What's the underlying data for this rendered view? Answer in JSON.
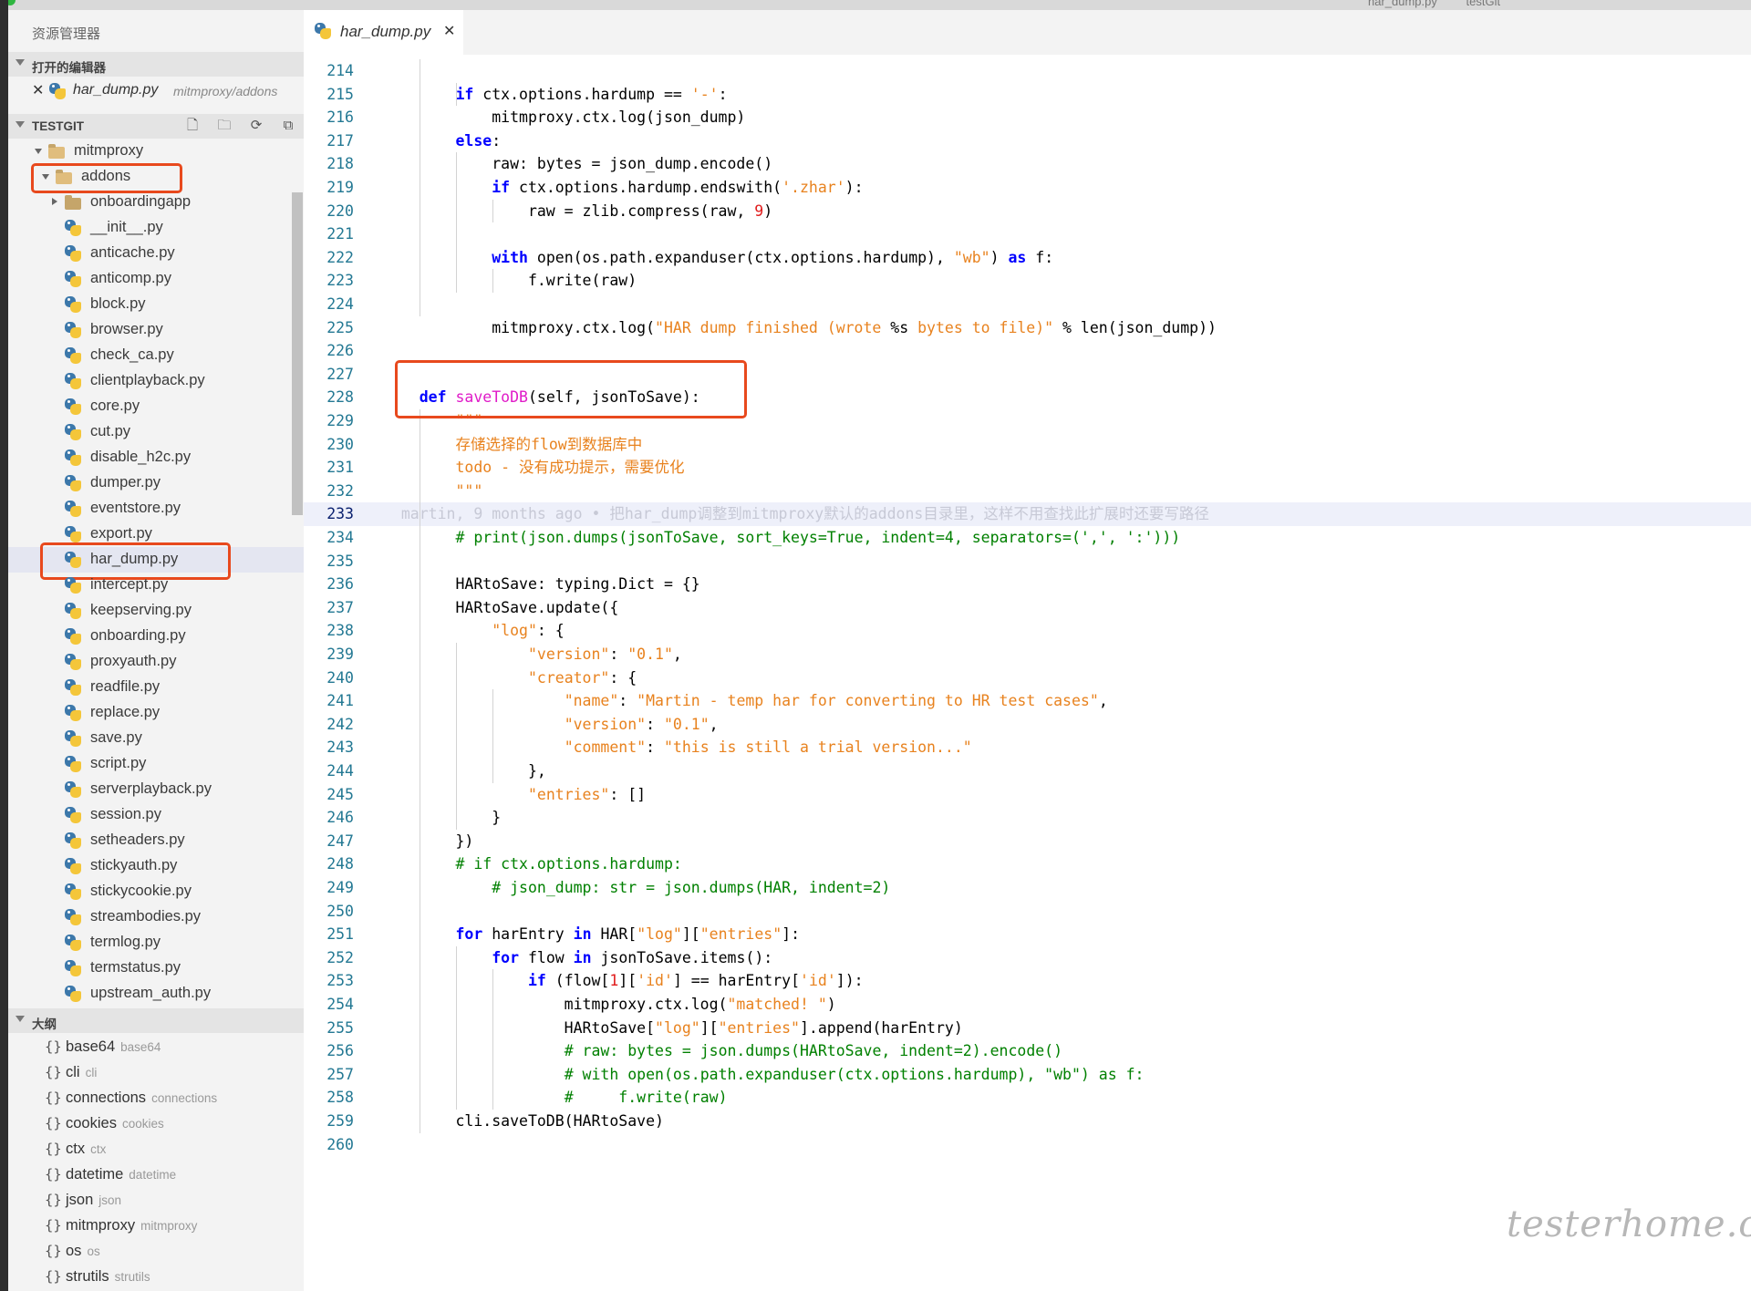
{
  "window": {
    "top_strip_text": [
      "har_dump.py",
      "testGit"
    ]
  },
  "sidebar": {
    "title": "资源管理器",
    "open_editors": {
      "label": "打开的编辑器",
      "items": [
        {
          "close": "✕",
          "name": "har_dump.py",
          "path": "mitmproxy/addons"
        }
      ]
    },
    "workspace": {
      "label": "TESTGIT",
      "actions": [
        {
          "name": "new-file",
          "glyph": "🗋"
        },
        {
          "name": "new-folder",
          "glyph": "🗀"
        },
        {
          "name": "refresh",
          "glyph": "⟳"
        },
        {
          "name": "collapse-all",
          "glyph": "⧉"
        }
      ],
      "tree": [
        {
          "label": "mitmproxy",
          "kind": "folder-open",
          "depth": 0
        },
        {
          "label": "addons",
          "kind": "folder-open",
          "depth": 1,
          "highlighted": true
        },
        {
          "label": "onboardingapp",
          "kind": "folder-closed",
          "depth": 2
        },
        {
          "label": "__init__.py",
          "kind": "py",
          "depth": 2
        },
        {
          "label": "anticache.py",
          "kind": "py",
          "depth": 2
        },
        {
          "label": "anticomp.py",
          "kind": "py",
          "depth": 2
        },
        {
          "label": "block.py",
          "kind": "py",
          "depth": 2
        },
        {
          "label": "browser.py",
          "kind": "py",
          "depth": 2
        },
        {
          "label": "check_ca.py",
          "kind": "py",
          "depth": 2
        },
        {
          "label": "clientplayback.py",
          "kind": "py",
          "depth": 2
        },
        {
          "label": "core.py",
          "kind": "py",
          "depth": 2
        },
        {
          "label": "cut.py",
          "kind": "py",
          "depth": 2
        },
        {
          "label": "disable_h2c.py",
          "kind": "py",
          "depth": 2
        },
        {
          "label": "dumper.py",
          "kind": "py",
          "depth": 2
        },
        {
          "label": "eventstore.py",
          "kind": "py",
          "depth": 2
        },
        {
          "label": "export.py",
          "kind": "py",
          "depth": 2
        },
        {
          "label": "har_dump.py",
          "kind": "py",
          "depth": 2,
          "selected": true,
          "highlighted": true
        },
        {
          "label": "intercept.py",
          "kind": "py",
          "depth": 2
        },
        {
          "label": "keepserving.py",
          "kind": "py",
          "depth": 2
        },
        {
          "label": "onboarding.py",
          "kind": "py",
          "depth": 2
        },
        {
          "label": "proxyauth.py",
          "kind": "py",
          "depth": 2
        },
        {
          "label": "readfile.py",
          "kind": "py",
          "depth": 2
        },
        {
          "label": "replace.py",
          "kind": "py",
          "depth": 2
        },
        {
          "label": "save.py",
          "kind": "py",
          "depth": 2
        },
        {
          "label": "script.py",
          "kind": "py",
          "depth": 2
        },
        {
          "label": "serverplayback.py",
          "kind": "py",
          "depth": 2
        },
        {
          "label": "session.py",
          "kind": "py",
          "depth": 2
        },
        {
          "label": "setheaders.py",
          "kind": "py",
          "depth": 2
        },
        {
          "label": "stickyauth.py",
          "kind": "py",
          "depth": 2
        },
        {
          "label": "stickycookie.py",
          "kind": "py",
          "depth": 2
        },
        {
          "label": "streambodies.py",
          "kind": "py",
          "depth": 2
        },
        {
          "label": "termlog.py",
          "kind": "py",
          "depth": 2
        },
        {
          "label": "termstatus.py",
          "kind": "py",
          "depth": 2
        },
        {
          "label": "upstream_auth.py",
          "kind": "py",
          "depth": 2
        }
      ]
    },
    "outline": {
      "label": "大纲",
      "items": [
        {
          "symbol": "{}",
          "name": "base64",
          "detail": "base64"
        },
        {
          "symbol": "{}",
          "name": "cli",
          "detail": "cli"
        },
        {
          "symbol": "{}",
          "name": "connections",
          "detail": "connections"
        },
        {
          "symbol": "{}",
          "name": "cookies",
          "detail": "cookies"
        },
        {
          "symbol": "{}",
          "name": "ctx",
          "detail": "ctx"
        },
        {
          "symbol": "{}",
          "name": "datetime",
          "detail": "datetime"
        },
        {
          "symbol": "{}",
          "name": "json",
          "detail": "json"
        },
        {
          "symbol": "{}",
          "name": "mitmproxy",
          "detail": "mitmproxy"
        },
        {
          "symbol": "{}",
          "name": "os",
          "detail": "os"
        },
        {
          "symbol": "{}",
          "name": "strutils",
          "detail": "strutils"
        }
      ]
    }
  },
  "editor": {
    "tab": {
      "label": "har_dump.py",
      "close": "✕"
    },
    "current_line": 233,
    "lines": [
      {
        "n": "214",
        "segs": []
      },
      {
        "n": "215",
        "segs": [
          [
            "",
            "        "
          ],
          [
            "kw",
            "if"
          ],
          [
            "",
            " ctx.options.hardump == "
          ],
          [
            "st",
            "'-'"
          ],
          [
            "",
            ":"
          ]
        ]
      },
      {
        "n": "216",
        "segs": [
          [
            "",
            "            mitmproxy.ctx.log(json_dump)"
          ]
        ]
      },
      {
        "n": "217",
        "segs": [
          [
            "",
            "        "
          ],
          [
            "kw",
            "else"
          ],
          [
            "",
            ":"
          ]
        ]
      },
      {
        "n": "218",
        "segs": [
          [
            "",
            "            raw: bytes = json_dump.encode()"
          ]
        ]
      },
      {
        "n": "219",
        "segs": [
          [
            "",
            "            "
          ],
          [
            "kw",
            "if"
          ],
          [
            "",
            " ctx.options.hardump.endswith("
          ],
          [
            "st",
            "'.zhar'"
          ],
          [
            "",
            "):"
          ]
        ]
      },
      {
        "n": "220",
        "segs": [
          [
            "",
            "                raw = zlib.compress(raw, "
          ],
          [
            "nr",
            "9"
          ],
          [
            "",
            ")"
          ]
        ]
      },
      {
        "n": "221",
        "segs": []
      },
      {
        "n": "222",
        "segs": [
          [
            "",
            "            "
          ],
          [
            "kw",
            "with"
          ],
          [
            "",
            " open(os.path.expanduser(ctx.options.hardump), "
          ],
          [
            "st",
            "\"wb\""
          ],
          [
            "",
            ") "
          ],
          [
            "kw",
            "as"
          ],
          [
            "",
            " f:"
          ]
        ]
      },
      {
        "n": "223",
        "segs": [
          [
            "",
            "                f.write(raw)"
          ]
        ]
      },
      {
        "n": "224",
        "segs": []
      },
      {
        "n": "225",
        "segs": [
          [
            "",
            "            mitmproxy.ctx.log("
          ],
          [
            "st",
            "\"HAR dump finished (wrote "
          ],
          [
            "",
            "%s"
          ],
          [
            "st",
            " bytes to file)\""
          ],
          [
            "",
            " % len(json_dump))"
          ]
        ]
      },
      {
        "n": "226",
        "segs": []
      },
      {
        "n": "227",
        "segs": []
      },
      {
        "n": "228",
        "segs": [
          [
            "",
            "    "
          ],
          [
            "kw",
            "def"
          ],
          [
            "",
            " "
          ],
          [
            "fn",
            "saveToDB"
          ],
          [
            "",
            "(self, jsonToSave):"
          ]
        ]
      },
      {
        "n": "229",
        "segs": [
          [
            "",
            "        "
          ],
          [
            "st",
            "\"\"\""
          ]
        ]
      },
      {
        "n": "230",
        "segs": [
          [
            "",
            "        "
          ],
          [
            "st",
            "存储选择的flow到数据库中"
          ]
        ]
      },
      {
        "n": "231",
        "segs": [
          [
            "",
            "        "
          ],
          [
            "st",
            "todo - 没有成功提示，需要优化"
          ]
        ]
      },
      {
        "n": "232",
        "segs": [
          [
            "",
            "        "
          ],
          [
            "st",
            "\"\"\""
          ]
        ]
      },
      {
        "n": "233",
        "segs": [
          [
            "blm",
            "  martin, 9 months ago • 把har_dump调整到mitmproxy默认的addons目录里，这样不用查找此扩展时还要写路径"
          ]
        ]
      },
      {
        "n": "234",
        "segs": [
          [
            "",
            "        "
          ],
          [
            "cm",
            "# print(json.dumps(jsonToSave, sort_keys=True, indent=4, separators=(',', ':')))"
          ]
        ]
      },
      {
        "n": "235",
        "segs": []
      },
      {
        "n": "236",
        "segs": [
          [
            "",
            "        HARtoSave: typing.Dict = {}"
          ]
        ]
      },
      {
        "n": "237",
        "segs": [
          [
            "",
            "        HARtoSave.update({"
          ]
        ]
      },
      {
        "n": "238",
        "segs": [
          [
            "",
            "            "
          ],
          [
            "st",
            "\"log\""
          ],
          [
            "",
            ": {"
          ]
        ]
      },
      {
        "n": "239",
        "segs": [
          [
            "",
            "                "
          ],
          [
            "st",
            "\"version\""
          ],
          [
            "",
            ": "
          ],
          [
            "st",
            "\"0.1\""
          ],
          [
            "",
            ","
          ]
        ]
      },
      {
        "n": "240",
        "segs": [
          [
            "",
            "                "
          ],
          [
            "st",
            "\"creator\""
          ],
          [
            "",
            ": {"
          ]
        ]
      },
      {
        "n": "241",
        "segs": [
          [
            "",
            "                    "
          ],
          [
            "st",
            "\"name\""
          ],
          [
            "",
            ": "
          ],
          [
            "st",
            "\"Martin - temp har for converting to HR test cases\""
          ],
          [
            "",
            ","
          ]
        ]
      },
      {
        "n": "242",
        "segs": [
          [
            "",
            "                    "
          ],
          [
            "st",
            "\"version\""
          ],
          [
            "",
            ": "
          ],
          [
            "st",
            "\"0.1\""
          ],
          [
            "",
            ","
          ]
        ]
      },
      {
        "n": "243",
        "segs": [
          [
            "",
            "                    "
          ],
          [
            "st",
            "\"comment\""
          ],
          [
            "",
            ": "
          ],
          [
            "st",
            "\"this is still a trial version...\""
          ]
        ]
      },
      {
        "n": "244",
        "segs": [
          [
            "",
            "                },"
          ]
        ]
      },
      {
        "n": "245",
        "segs": [
          [
            "",
            "                "
          ],
          [
            "st",
            "\"entries\""
          ],
          [
            "",
            ": []"
          ]
        ]
      },
      {
        "n": "246",
        "segs": [
          [
            "",
            "            }"
          ]
        ]
      },
      {
        "n": "247",
        "segs": [
          [
            "",
            "        })"
          ]
        ]
      },
      {
        "n": "248",
        "segs": [
          [
            "",
            "        "
          ],
          [
            "cm",
            "# if ctx.options.hardump:"
          ]
        ]
      },
      {
        "n": "249",
        "segs": [
          [
            "",
            "            "
          ],
          [
            "cm",
            "# json_dump: str = json.dumps(HAR, indent=2)"
          ]
        ]
      },
      {
        "n": "250",
        "segs": []
      },
      {
        "n": "251",
        "segs": [
          [
            "",
            "        "
          ],
          [
            "kw",
            "for"
          ],
          [
            "",
            " harEntry "
          ],
          [
            "kw",
            "in"
          ],
          [
            "",
            " HAR["
          ],
          [
            "st",
            "\"log\""
          ],
          [
            "",
            "]["
          ],
          [
            "st",
            "\"entries\""
          ],
          [
            "",
            "]:"
          ]
        ]
      },
      {
        "n": "252",
        "segs": [
          [
            "",
            "            "
          ],
          [
            "kw",
            "for"
          ],
          [
            "",
            " flow "
          ],
          [
            "kw",
            "in"
          ],
          [
            "",
            " jsonToSave.items():"
          ]
        ]
      },
      {
        "n": "253",
        "segs": [
          [
            "",
            "                "
          ],
          [
            "kw",
            "if"
          ],
          [
            "",
            " (flow["
          ],
          [
            "nr",
            "1"
          ],
          [
            "",
            "]["
          ],
          [
            "st",
            "'id'"
          ],
          [
            "",
            "] == harEntry["
          ],
          [
            "st",
            "'id'"
          ],
          [
            "",
            "]):"
          ]
        ]
      },
      {
        "n": "254",
        "segs": [
          [
            "",
            "                    mitmproxy.ctx.log("
          ],
          [
            "st",
            "\"matched! \""
          ],
          [
            "",
            ")"
          ]
        ]
      },
      {
        "n": "255",
        "segs": [
          [
            "",
            "                    HARtoSave["
          ],
          [
            "st",
            "\"log\""
          ],
          [
            "",
            "]["
          ],
          [
            "st",
            "\"entries\""
          ],
          [
            "",
            "].append(harEntry)"
          ]
        ]
      },
      {
        "n": "256",
        "segs": [
          [
            "",
            "                    "
          ],
          [
            "cm",
            "# raw: bytes = json.dumps(HARtoSave, indent=2).encode()"
          ]
        ]
      },
      {
        "n": "257",
        "segs": [
          [
            "",
            "                    "
          ],
          [
            "cm",
            "# with open(os.path.expanduser(ctx.options.hardump), \"wb\") as f:"
          ]
        ]
      },
      {
        "n": "258",
        "segs": [
          [
            "",
            "                    "
          ],
          [
            "cm",
            "#     f.write(raw)"
          ]
        ]
      },
      {
        "n": "259",
        "segs": [
          [
            "",
            "        cli.saveToDB(HARtoSave)"
          ]
        ]
      },
      {
        "n": "260",
        "segs": []
      }
    ]
  },
  "watermark": "testerhome.com",
  "colors": {
    "highlight_box": "#e8491d",
    "keyword": "#0000ff",
    "string": "#e8821e",
    "comment": "#008000",
    "function": "#e01bc8",
    "number": "#e01b1b",
    "line_number": "#237893"
  }
}
